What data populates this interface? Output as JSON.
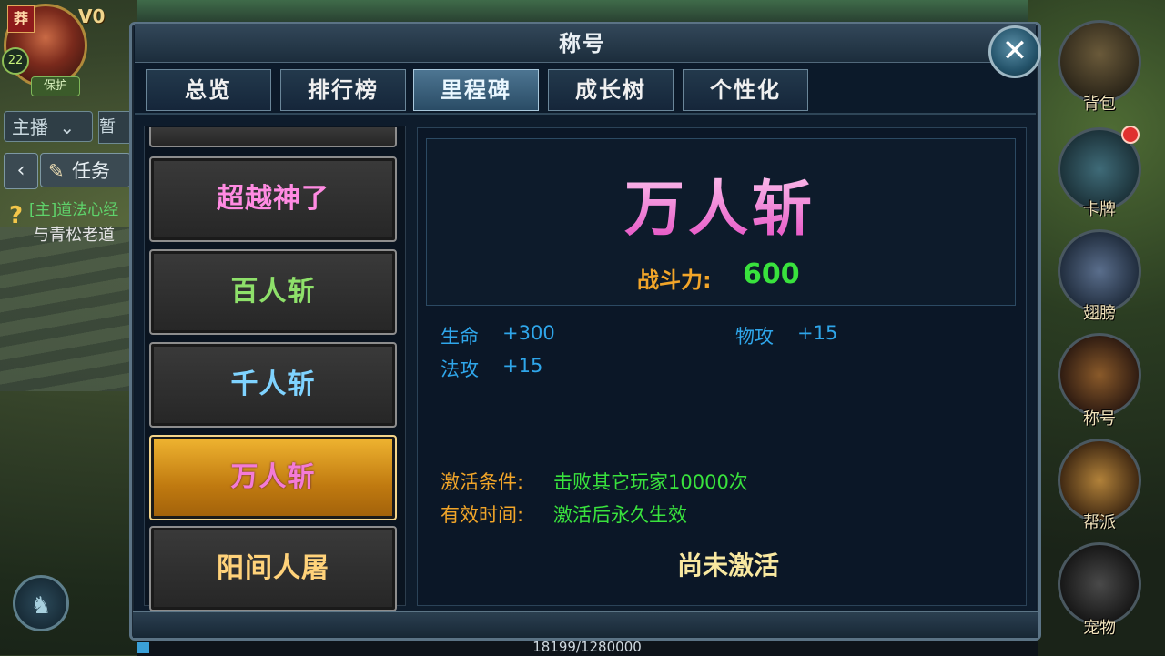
{
  "hud": {
    "badge": "莽",
    "vip": "V0",
    "level": "22",
    "protect": "保护",
    "zhubo": "主播",
    "zan": "暂",
    "task": "任务",
    "quest_line1": "[主]道法心经",
    "quest_line2": "与青松老道",
    "side_buttons": [
      "背包",
      "卡牌",
      "翅膀",
      "称号",
      "帮派",
      "宠物"
    ]
  },
  "dialog": {
    "title": "称号",
    "tabs": [
      "总览",
      "排行榜",
      "里程碑",
      "成长树",
      "个性化"
    ],
    "active_tab": "里程碑"
  },
  "titles_list": {
    "items": [
      {
        "label": "超越神了",
        "color": "#ff8be2"
      },
      {
        "label": "百人斩",
        "color": "#8ee06a"
      },
      {
        "label": "千人斩",
        "color": "#7fd3ff"
      },
      {
        "label": "万人斩",
        "color": "#f47bd6"
      },
      {
        "label": "阳间人屠",
        "color": "#ffd27a"
      }
    ],
    "selected": "万人斩"
  },
  "detail": {
    "name": "万人斩",
    "power_label": "战斗力:",
    "power_value": "600",
    "stats": [
      {
        "name": "生命",
        "value": "+300"
      },
      {
        "name": "物攻",
        "value": "+15"
      },
      {
        "name": "法攻",
        "value": "+15"
      }
    ],
    "activation_label": "激活条件:",
    "activation_value": "击败其它玩家10000次",
    "duration_label": "有效时间:",
    "duration_value": "激活后永久生效",
    "status": "尚未激活"
  },
  "exp": {
    "text": "18199/1280000",
    "fraction": 0.0142
  }
}
